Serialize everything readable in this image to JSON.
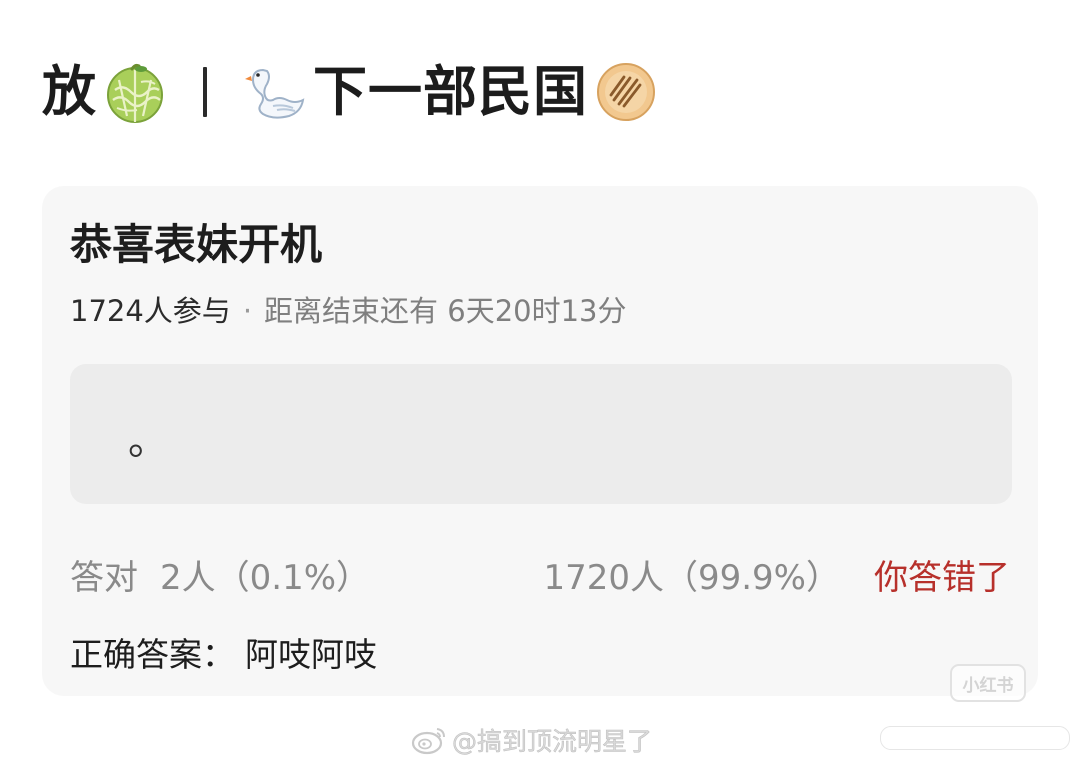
{
  "header": {
    "text_left": "放",
    "text_right": "下一部民国",
    "emoji_1": "melon-icon",
    "emoji_2": "swan-icon",
    "emoji_3": "flatbread-icon"
  },
  "quiz": {
    "title": "恭喜表妹开机",
    "participants": "1724人参与",
    "dot": "·",
    "remaining": "距离结束还有 6天20时13分",
    "option_text": "。",
    "correct_label": "答对",
    "correct_stat": "2人（0.1%）",
    "wrong_stat": "1720人（99.9%）",
    "wrong_verdict": "你答错了",
    "answer_label": "正确答案：",
    "answer_value": "阿吱阿吱"
  },
  "watermarks": {
    "badge": "小红书",
    "weibo_handle": "@搞到顶流明星了"
  },
  "colors": {
    "card_bg": "#f7f7f7",
    "option_bg": "#ececec",
    "wrong_red": "#b7302b",
    "muted_gray": "#8a8a8a"
  }
}
